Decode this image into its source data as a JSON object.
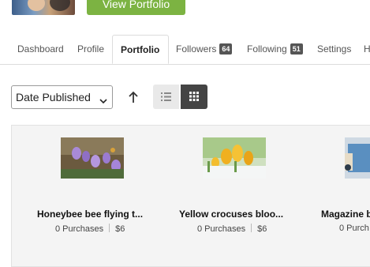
{
  "header": {
    "view_portfolio_label": "View Portfolio"
  },
  "tabs": [
    {
      "label": "Dashboard"
    },
    {
      "label": "Profile"
    },
    {
      "label": "Portfolio",
      "active": true
    },
    {
      "label": "Followers",
      "count": "64"
    },
    {
      "label": "Following",
      "count": "51"
    },
    {
      "label": "Settings"
    },
    {
      "label": "H"
    }
  ],
  "toolbar": {
    "sort_value": "Date Published",
    "sort_direction_icon": "arrow-up-icon",
    "view_modes": [
      "list-view",
      "grid-view"
    ],
    "active_view": "grid-view"
  },
  "items": [
    {
      "title": "Honeybee bee flying t...",
      "purchases": "0 Purchases",
      "price": "$6"
    },
    {
      "title": "Yellow crocuses bloo...",
      "purchases": "0 Purchases",
      "price": "$6"
    },
    {
      "title": "Magazine b",
      "purchases": "0 Purch",
      "price": ""
    }
  ],
  "colors": {
    "accent_green": "#7cb342",
    "active_toggle": "#444444",
    "badge_bg": "#555555"
  }
}
